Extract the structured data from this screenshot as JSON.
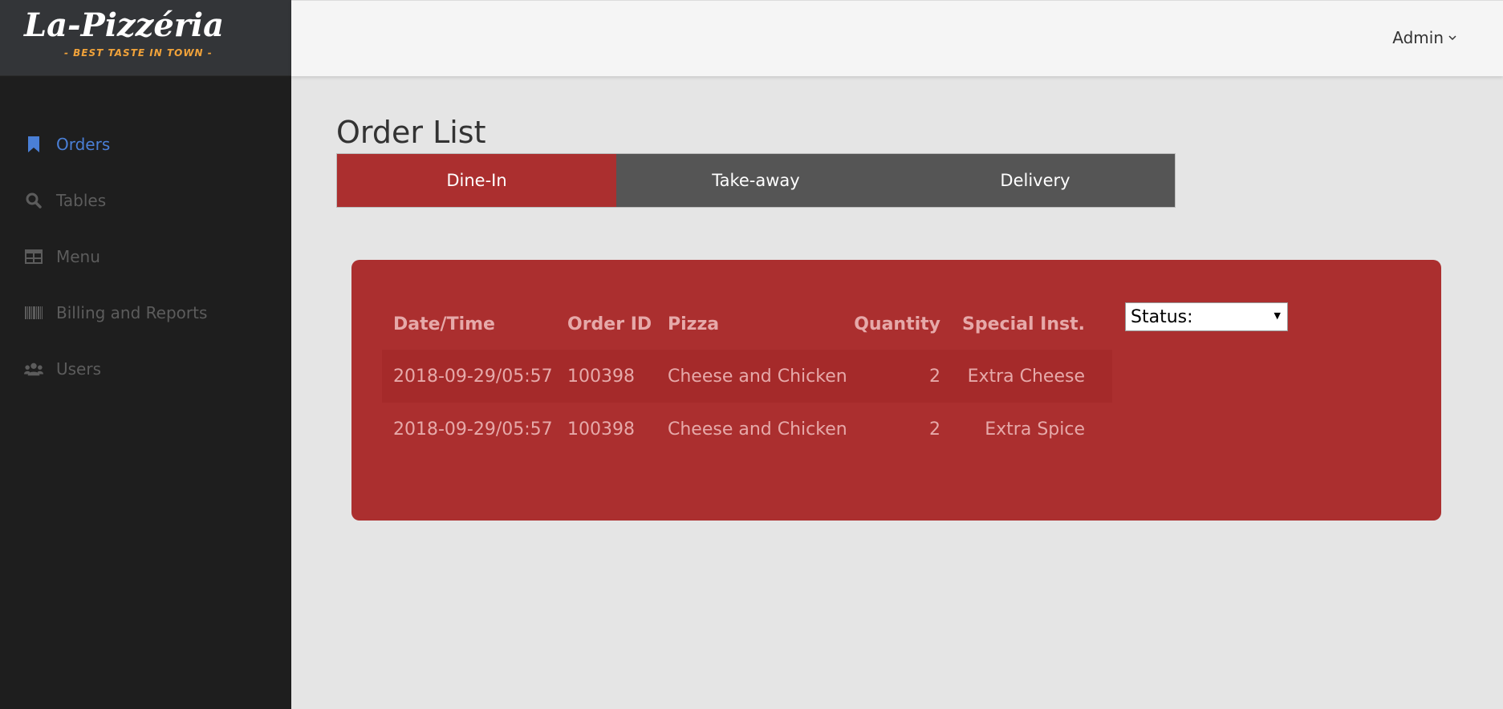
{
  "brand": {
    "title": "La-Pizzéria",
    "tagline": "- BEST TASTE IN TOWN -"
  },
  "header": {
    "user": "Admin"
  },
  "sidebar": {
    "items": [
      {
        "label": "Orders",
        "icon": "bookmark-icon",
        "active": true
      },
      {
        "label": "Tables",
        "icon": "search-icon"
      },
      {
        "label": "Menu",
        "icon": "table-icon"
      },
      {
        "label": "Billing and Reports",
        "icon": "barcode-icon"
      },
      {
        "label": "Users",
        "icon": "users-icon"
      }
    ]
  },
  "main": {
    "title": "Order List",
    "tabs": [
      {
        "label": "Dine-In",
        "active": true
      },
      {
        "label": "Take-away"
      },
      {
        "label": "Delivery"
      }
    ],
    "table": {
      "columns": [
        "Date/Time",
        "Order ID",
        "Pizza",
        "Quantity",
        "Special Inst."
      ],
      "rows": [
        [
          "2018-09-29/05:57",
          "100398",
          "Cheese and Chicken",
          "2",
          "Extra Cheese"
        ],
        [
          "2018-09-29/05:57",
          "100398",
          "Cheese and Chicken",
          "2",
          "Extra Spice"
        ]
      ]
    },
    "status_select": {
      "value": "Status:"
    }
  },
  "colors": {
    "accent": "#ab2f2f",
    "tab_inactive": "#555555",
    "sidebar": "#1e1e1e",
    "active_link": "#4a7fd6"
  }
}
